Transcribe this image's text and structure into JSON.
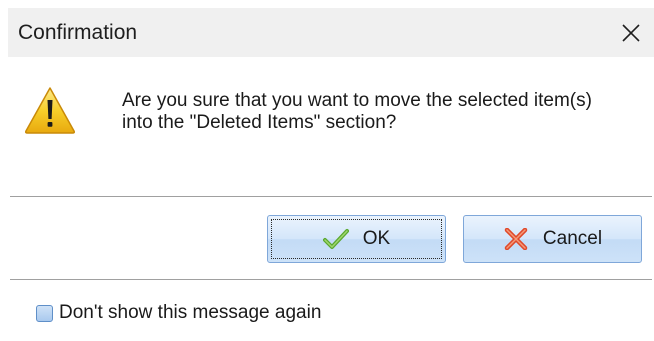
{
  "window": {
    "title": "Confirmation",
    "close_icon": "close-icon"
  },
  "message": {
    "icon": "warning-icon",
    "text": "Are you sure that you want to move the selected item(s) into the \"Deleted Items\" section?"
  },
  "buttons": {
    "ok_label": "OK",
    "ok_icon": "checkmark-icon",
    "cancel_label": "Cancel",
    "cancel_icon": "cross-icon"
  },
  "checkbox": {
    "label": "Don't show this message again",
    "checked": false
  },
  "colors": {
    "titlebar": "#f0f0f0",
    "button_border": "#7fa7d9",
    "warning_yellow": "#f5c81c",
    "ok_green": "#5aa82f",
    "cancel_red": "#e0492a"
  }
}
